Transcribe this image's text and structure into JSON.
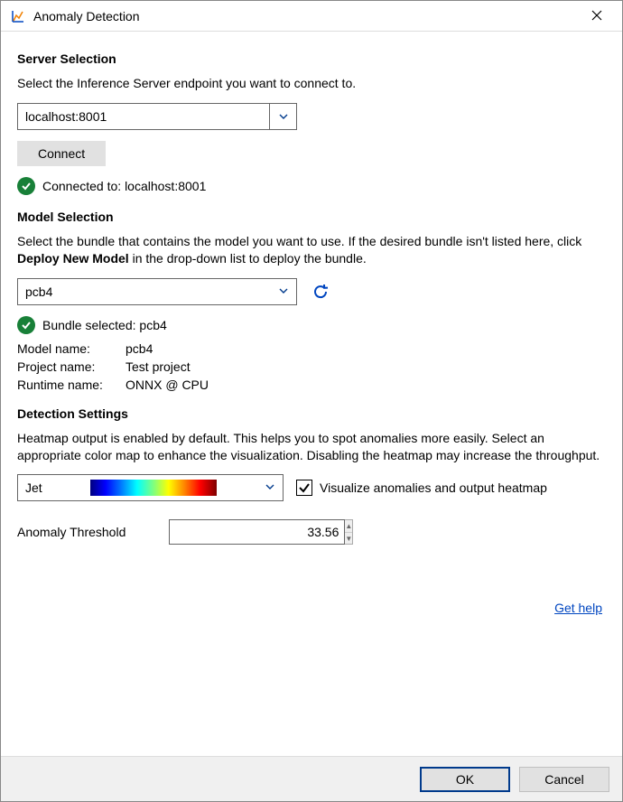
{
  "window": {
    "title": "Anomaly Detection"
  },
  "server": {
    "header": "Server Selection",
    "desc": "Select the Inference Server endpoint you want to connect to.",
    "value": "localhost:8001",
    "connect_label": "Connect",
    "status_prefix": "Connected to: ",
    "status_value": "localhost:8001"
  },
  "model": {
    "header": "Model Selection",
    "desc_before": "Select the bundle that contains the model you want to use. If the desired bundle isn't listed here, click ",
    "desc_bold": "Deploy New Model",
    "desc_after": " in the drop-down list to deploy the bundle.",
    "selected": "pcb4",
    "status_prefix": "Bundle selected: ",
    "status_value": "pcb4",
    "props": {
      "model_name_label": "Model name:",
      "model_name_value": "pcb4",
      "project_name_label": "Project name:",
      "project_name_value": "Test project",
      "runtime_name_label": "Runtime name:",
      "runtime_name_value": "ONNX @ CPU"
    }
  },
  "detection": {
    "header": "Detection Settings",
    "desc": "Heatmap output is enabled by default. This helps you to spot anomalies more easily. Select an appropriate color map to enhance the visualization. Disabling the heatmap may increase the throughput.",
    "colormap_selected": "Jet",
    "heatmap_checkbox_label": "Visualize anomalies and output heatmap",
    "heatmap_checked": true,
    "threshold_label": "Anomaly Threshold",
    "threshold_value": "33.56"
  },
  "help": {
    "label": "Get help"
  },
  "footer": {
    "ok": "OK",
    "cancel": "Cancel"
  }
}
